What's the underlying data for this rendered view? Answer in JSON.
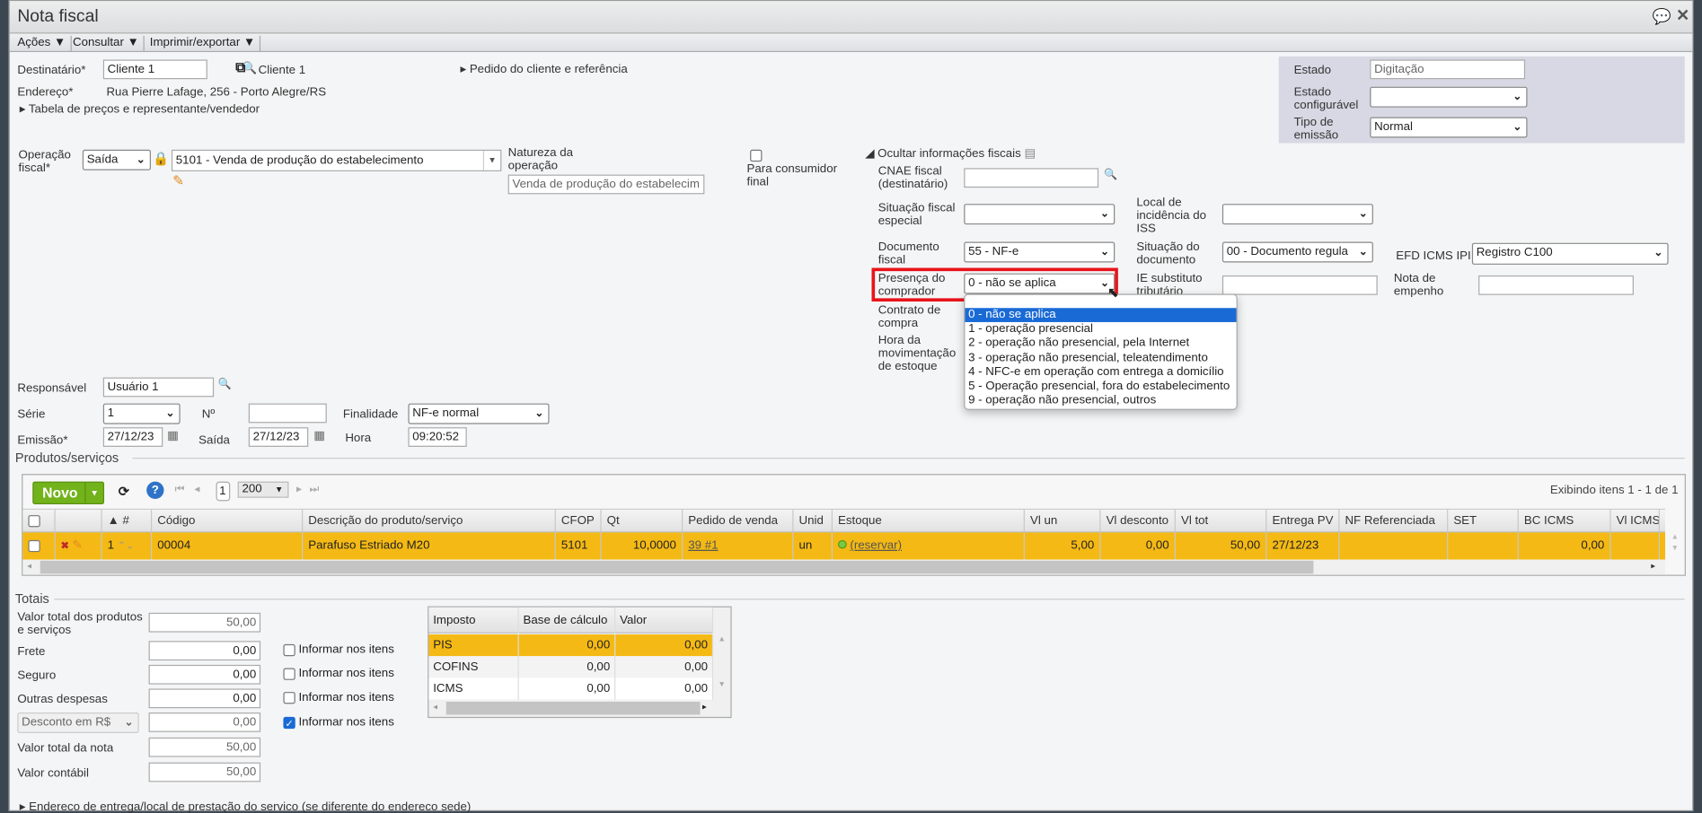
{
  "window": {
    "title": "Nota fiscal"
  },
  "menu": [
    "Ações ▼",
    "Consultar ▼",
    "Imprimir/exportar ▼"
  ],
  "header": {
    "destinatario_label": "Destinatário*",
    "destinatario_value": "Cliente 1",
    "destinatario_link": "Cliente 1",
    "endereco_label": "Endereço*",
    "endereco_value": "Rua Pierre Lafage, 256 - Porto Alegre/RS",
    "tabela_link": "Tabela de preços e representante/vendedor",
    "pedido_link": "Pedido do cliente e referência"
  },
  "estado": {
    "estado_label": "Estado",
    "estado_value": "Digitação",
    "config_label": "Estado configurável",
    "config_value": "",
    "tipo_label": "Tipo de emissão",
    "tipo_value": "Normal"
  },
  "operacao": {
    "label": "Operação fiscal*",
    "tipo": "Saída",
    "cfop": "5101 - Venda de produção do estabelecimento",
    "natureza_label": "Natureza da operação",
    "natureza_value": "Venda de produção do estabelecim",
    "consumidor_label": "Para consumidor final",
    "consumidor_checked": false
  },
  "fiscal": {
    "toggle": "Ocultar informações fiscais",
    "cnae_label": "CNAE fiscal (destinatário)",
    "cnae_value": "",
    "sit_especial_label": "Situação fiscal especial",
    "sit_especial_value": "",
    "local_iss_label": "Local de incidência do ISS",
    "local_iss_value": "",
    "doc_label": "Documento fiscal",
    "doc_value": "55 - NF-e",
    "sit_doc_label": "Situação do documento",
    "sit_doc_value": "00 - Documento regula",
    "efd_label": "EFD ICMS IPI",
    "efd_value": "Registro C100",
    "presenca_label": "Presença do comprador",
    "presenca_value": "0 - não se aplica",
    "ie_label": "IE substituto tributário",
    "ie_value": "",
    "empenho_label": "Nota de empenho",
    "empenho_value": "",
    "contrato_label": "Contrato de compra",
    "hora_mov_label": "Hora da movimentação de estoque",
    "presenca_options": [
      "0 - não se aplica",
      "1 - operação presencial",
      "2 - operação não presencial, pela Internet",
      "3 - operação não presencial, teleatendimento",
      "4 - NFC-e em operação com entrega a domicílio",
      "5 - Operação presencial, fora do estabelecimento",
      "9 - operação não presencial, outros"
    ]
  },
  "geral": {
    "responsavel_label": "Responsável",
    "responsavel_value": "Usuário 1",
    "serie_label": "Série",
    "serie_value": "1",
    "numero_label": "Nº",
    "numero_value": "",
    "finalidade_label": "Finalidade",
    "finalidade_value": "NF-e normal",
    "emissao_label": "Emissão*",
    "emissao_value": "27/12/23",
    "saida_label": "Saída",
    "saida_value": "27/12/23",
    "hora_label": "Hora",
    "hora_value": "09:20:52"
  },
  "produtos": {
    "legend": "Produtos/serviços",
    "novo": "Novo",
    "page": "1",
    "page_size": "200",
    "status": "Exibindo itens 1 - 1 de 1",
    "columns": [
      "",
      "",
      "▲ #",
      "Código",
      "Descrição do produto/serviço",
      "CFOP",
      "Qt",
      "Pedido de venda",
      "Unid",
      "Estoque",
      "Vl un",
      "Vl desconto",
      "Vl tot",
      "Entrega PV",
      "NF Referenciada",
      "SET",
      "BC ICMS",
      "Vl ICMS"
    ],
    "rows": [
      {
        "num": "1",
        "codigo": "00004",
        "descricao": "Parafuso Estriado M20",
        "cfop": "5101",
        "qt": "10,0000",
        "pedido": "39 #1",
        "unid": "un",
        "estoque": "(reservar)",
        "vl_un": "5,00",
        "vl_desconto": "0,00",
        "vl_tot": "50,00",
        "entrega": "27/12/23",
        "nf_ref": "",
        "set": "",
        "bc_icms": "0,00",
        "vl_icms": ""
      }
    ]
  },
  "totais": {
    "legend": "Totais",
    "produtos_label": "Valor total dos produtos e serviços",
    "produtos_value": "50,00",
    "frete_label": "Frete",
    "frete_value": "0,00",
    "seguro_label": "Seguro",
    "seguro_value": "0,00",
    "outras_label": "Outras despesas",
    "outras_value": "0,00",
    "desconto_select": "Desconto em R$",
    "desconto_value": "0,00",
    "nota_label": "Valor total da nota",
    "nota_value": "50,00",
    "contabil_label": "Valor contábil",
    "contabil_value": "50,00",
    "informar_label": "Informar nos itens",
    "informar_checked": [
      false,
      false,
      false,
      true
    ]
  },
  "impostos": {
    "columns": [
      "Imposto",
      "Base de cálculo",
      "Valor"
    ],
    "rows": [
      [
        "PIS",
        "0,00",
        "0,00"
      ],
      [
        "COFINS",
        "0,00",
        "0,00"
      ],
      [
        "ICMS",
        "0,00",
        "0,00"
      ]
    ]
  },
  "footer": {
    "endereco_link": "Endereco de entrega/local de prestação do servico (se diferente do endereco sede)"
  },
  "colors": {
    "selected_row": "#f4b914",
    "accent": "#1a6ad6",
    "novo": "#72b21b",
    "highlight": "#e8141b"
  }
}
